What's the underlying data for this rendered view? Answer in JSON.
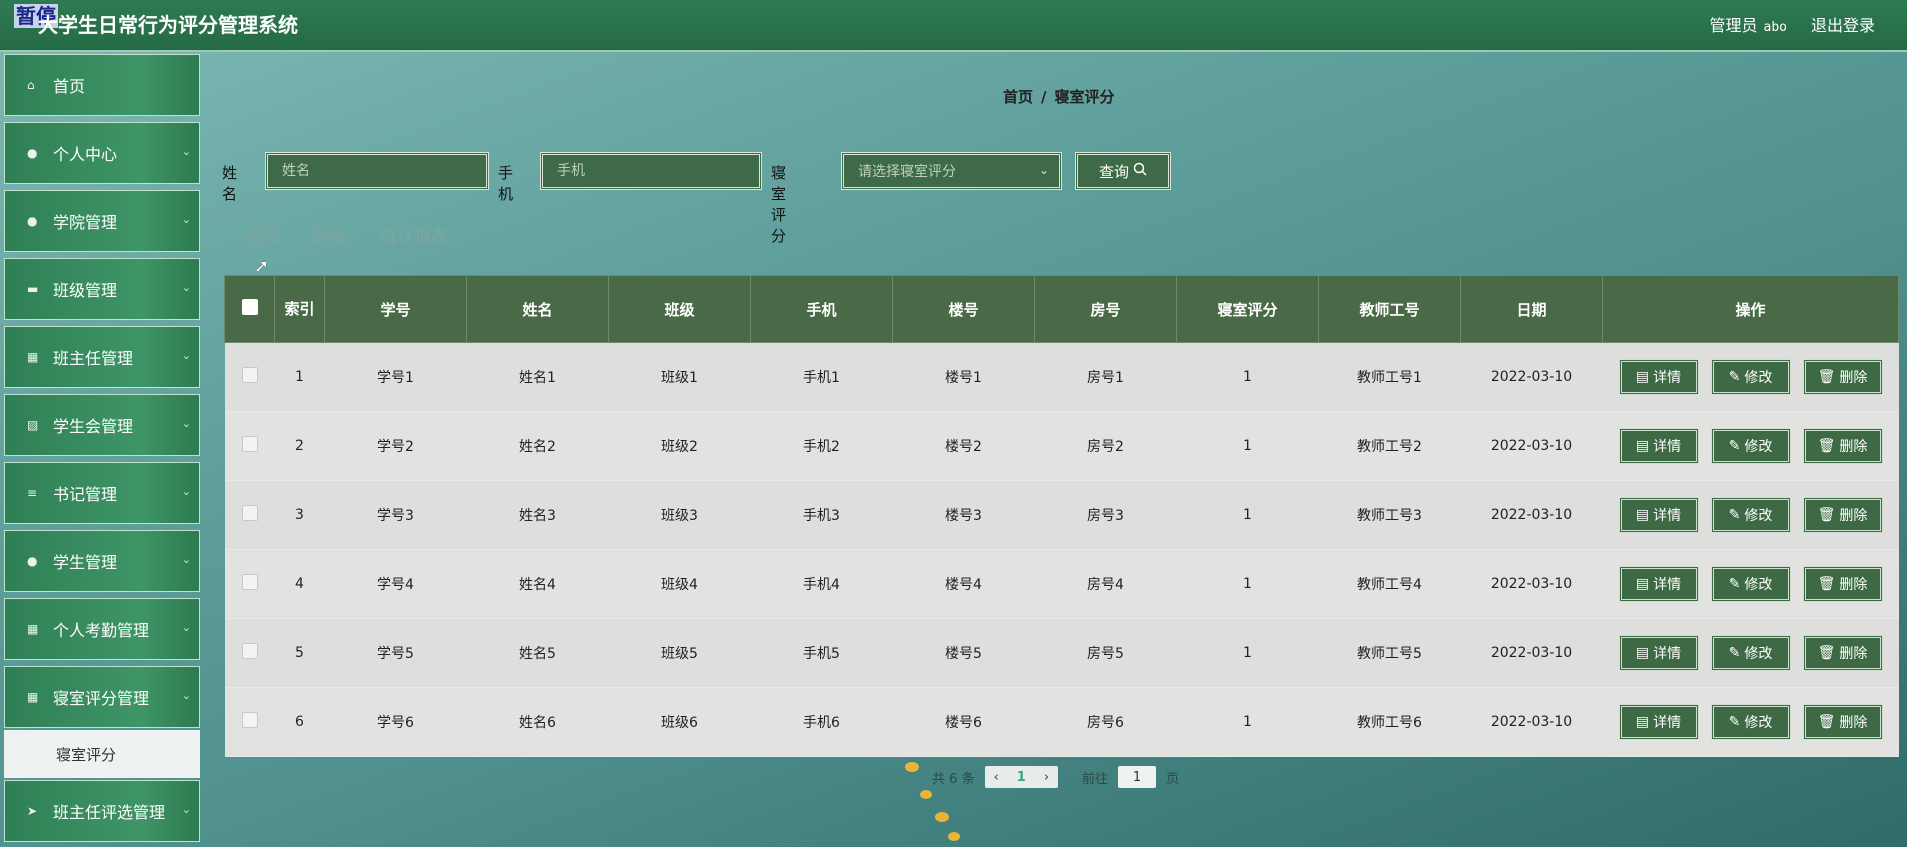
{
  "overlay_tag": "暂停",
  "app": {
    "title": "大学生日常行为评分管理系统"
  },
  "header": {
    "role": "管理员",
    "user": "abo",
    "logout": "退出登录"
  },
  "sidebar": {
    "items": [
      {
        "label": "首页",
        "icon": "home-icon"
      },
      {
        "label": "个人中心",
        "icon": "user-icon"
      },
      {
        "label": "学院管理",
        "icon": "user-icon"
      },
      {
        "label": "班级管理",
        "icon": "chat-icon"
      },
      {
        "label": "班主任管理",
        "icon": "grid-icon"
      },
      {
        "label": "学生会管理",
        "icon": "chart-icon"
      },
      {
        "label": "书记管理",
        "icon": "menu-icon"
      },
      {
        "label": "学生管理",
        "icon": "user-icon"
      },
      {
        "label": "个人考勤管理",
        "icon": "grid-icon"
      },
      {
        "label": "寝室评分管理",
        "icon": "grid-icon"
      }
    ],
    "active_sub": "寝室评分",
    "after": {
      "label": "班主任评选管理",
      "icon": "send-icon"
    }
  },
  "breadcrumb": {
    "home": "首页",
    "sep": "/",
    "current": "寝室评分"
  },
  "search": {
    "name_label": "姓名",
    "name_placeholder": "姓名",
    "phone_label": "手机",
    "phone_placeholder": "手机",
    "score_label": "寝室评分",
    "score_placeholder": "请选择寝室评分",
    "query_label": "查询"
  },
  "actions": {
    "add": "新增",
    "delete": "删除",
    "report": "统计报表"
  },
  "table": {
    "headers": [
      "索引",
      "学号",
      "姓名",
      "班级",
      "手机",
      "楼号",
      "房号",
      "寝室评分",
      "教师工号",
      "日期",
      "操作"
    ],
    "rows": [
      [
        "1",
        "学号1",
        "姓名1",
        "班级1",
        "手机1",
        "楼号1",
        "房号1",
        "1",
        "教师工号1",
        "2022-03-10"
      ],
      [
        "2",
        "学号2",
        "姓名2",
        "班级2",
        "手机2",
        "楼号2",
        "房号2",
        "1",
        "教师工号2",
        "2022-03-10"
      ],
      [
        "3",
        "学号3",
        "姓名3",
        "班级3",
        "手机3",
        "楼号3",
        "房号3",
        "1",
        "教师工号3",
        "2022-03-10"
      ],
      [
        "4",
        "学号4",
        "姓名4",
        "班级4",
        "手机4",
        "楼号4",
        "房号4",
        "1",
        "教师工号4",
        "2022-03-10"
      ],
      [
        "5",
        "学号5",
        "姓名5",
        "班级5",
        "手机5",
        "楼号5",
        "房号5",
        "1",
        "教师工号5",
        "2022-03-10"
      ],
      [
        "6",
        "学号6",
        "姓名6",
        "班级6",
        "手机6",
        "楼号6",
        "房号6",
        "1",
        "教师工号6",
        "2022-03-10"
      ]
    ],
    "row_actions": {
      "detail": "详情",
      "edit": "修改",
      "delete": "删除"
    }
  },
  "pagination": {
    "total_prefix": "共",
    "total": "6",
    "total_suffix": "条",
    "current_page": "1",
    "goto_label": "前往",
    "goto_value": "1",
    "page_suffix": "页"
  },
  "colors": {
    "header": "#2f7a52",
    "sidebar": "#3e9566",
    "table_header": "#4a6a47",
    "button": "#3d6a44"
  }
}
